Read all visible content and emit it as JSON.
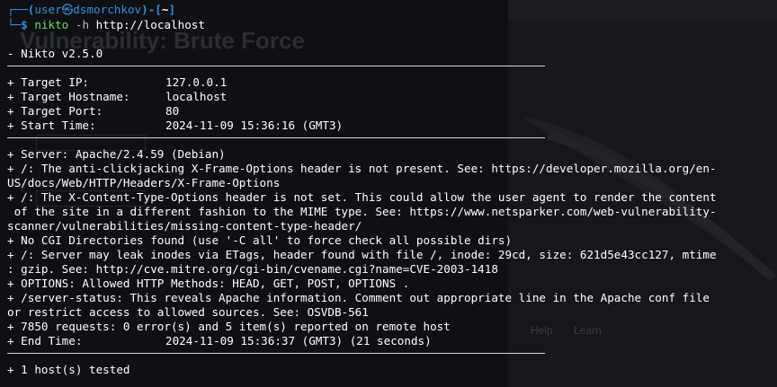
{
  "background": {
    "heading": "Vulnerability: Brute Force",
    "links": [
      "Help",
      "Learn"
    ]
  },
  "prompt": {
    "user": "user",
    "separator": "㉿",
    "host": "dsmorchkov",
    "dir": "~",
    "command": "nikto",
    "flag": "-h",
    "argument": "http://localhost"
  },
  "output": {
    "version": "- Nikto v2.5.0",
    "target_ip_label": "+ Target IP:",
    "target_ip": "127.0.0.1",
    "target_hostname_label": "+ Target Hostname:",
    "target_hostname": "localhost",
    "target_port_label": "+ Target Port:",
    "target_port": "80",
    "start_time_label": "+ Start Time:",
    "start_time": "2024-11-09 15:36:16 (GMT3)",
    "lines": [
      "+ Server: Apache/2.4.59 (Debian)",
      "+ /: The anti-clickjacking X-Frame-Options header is not present. See: https://developer.mozilla.org/en-",
      "US/docs/Web/HTTP/Headers/X-Frame-Options",
      "+ /: The X-Content-Type-Options header is not set. This could allow the user agent to render the content",
      " of the site in a different fashion to the MIME type. See: https://www.netsparker.com/web-vulnerability-",
      "scanner/vulnerabilities/missing-content-type-header/",
      "+ No CGI Directories found (use '-C all' to force check all possible dirs)",
      "+ /: Server may leak inodes via ETags, header found with file /, inode: 29cd, size: 621d5e43cc127, mtime",
      ": gzip. See: http://cve.mitre.org/cgi-bin/cvename.cgi?name=CVE-2003-1418",
      "+ OPTIONS: Allowed HTTP Methods: HEAD, GET, POST, OPTIONS .",
      "+ /server-status: This reveals Apache information. Comment out appropriate line in the Apache conf file",
      "or restrict access to allowed sources. See: OSVDB-561",
      "+ 7850 requests: 0 error(s) and 5 item(s) reported on remote host"
    ],
    "end_time_label": "+ End Time:",
    "end_time": "2024-11-09 15:36:37 (GMT3) (21 seconds)",
    "hosts_tested": "+ 1 host(s) tested"
  }
}
